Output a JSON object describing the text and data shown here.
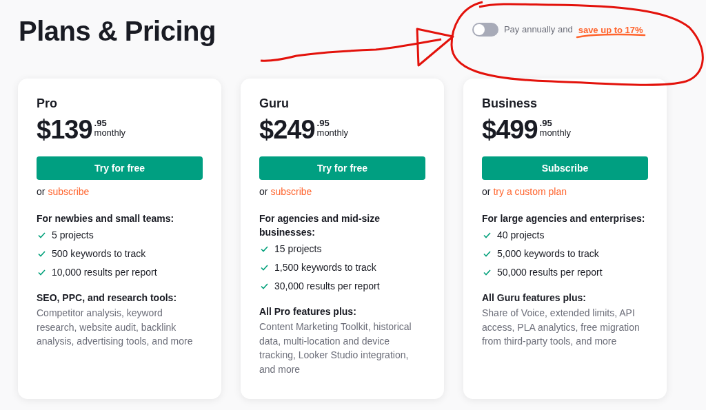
{
  "title": "Plans & Pricing",
  "billing_toggle": {
    "on": false,
    "label": "Pay annually and",
    "highlight": "save up to 17%"
  },
  "plans": [
    {
      "name": "Pro",
      "price": "$139",
      "cents": ".95",
      "period": "monthly",
      "button": "Try for free",
      "alt_prefix": "or",
      "alt_link": "subscribe",
      "audience": "For newbies and small teams:",
      "features": [
        "5 projects",
        "500 keywords to track",
        "10,000 results per report"
      ],
      "extras_title": "SEO, PPC, and research tools:",
      "extras": "Competitor analysis, keyword research, website audit, backlink analysis, advertising tools, and more"
    },
    {
      "name": "Guru",
      "price": "$249",
      "cents": ".95",
      "period": "monthly",
      "button": "Try for free",
      "alt_prefix": "or",
      "alt_link": "subscribe",
      "audience": "For agencies and mid-size businesses:",
      "features": [
        "15 projects",
        "1,500 keywords to track",
        "30,000 results per report"
      ],
      "extras_title": "All Pro features plus:",
      "extras": "Content Marketing Toolkit, historical data, multi-location and device tracking, Looker Studio integration, and more"
    },
    {
      "name": "Business",
      "price": "$499",
      "cents": ".95",
      "period": "monthly",
      "button": "Subscribe",
      "alt_prefix": "or",
      "alt_link": "try a custom plan",
      "audience": "For large agencies and enterprises:",
      "features": [
        "40 projects",
        "5,000 keywords to track",
        "50,000 results per report"
      ],
      "extras_title": "All Guru features plus:",
      "extras": "Share of Voice, extended limits, API access, PLA analytics, free migration from third-party tools, and more"
    }
  ]
}
